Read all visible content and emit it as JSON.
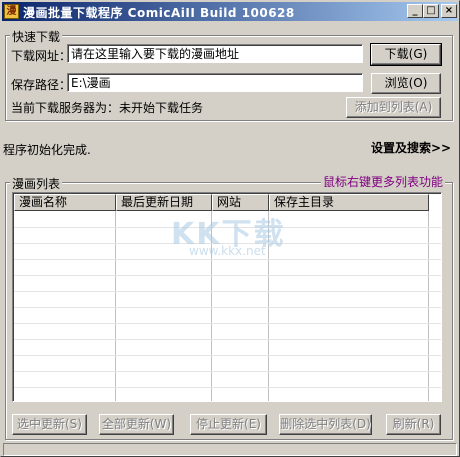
{
  "window": {
    "title": "漫画批量下载程序 ComicAiII Build 100628",
    "controls": {
      "minimize": "_",
      "maximize": "□",
      "close": "×"
    }
  },
  "quick_download": {
    "title": "快速下载",
    "url_label": "下载网址：",
    "url_value": "请在这里输入要下载的漫画地址",
    "download_button": "下载(G)",
    "path_label": "保存路径：",
    "path_value": "E:\\漫画",
    "browse_button": "浏览(O)",
    "server_status": "当前下载服务器为：未开始下载任务",
    "add_list_button": "添加到列表(A)"
  },
  "status_message": "程序初始化完成.",
  "settings_link": "设置及搜索>>",
  "comic_list": {
    "title": "漫画列表",
    "hint": "鼠标右键更多列表功能",
    "columns": [
      "漫画名称",
      "最后更新日期",
      "网站",
      "保存主目录"
    ]
  },
  "bottom_buttons": {
    "update_selected": "选中更新(S)",
    "update_all": "全部更新(W)",
    "stop_update": "停止更新(E)",
    "delete_selected": "删除选中列表(D)",
    "refresh": "刷新(R)"
  },
  "watermark": {
    "logo": "KK下载",
    "url": "www.kkx.net"
  },
  "colors": {
    "hint": "#800080",
    "face": "#d4d0c8",
    "title_start": "#0a246a",
    "title_end": "#a6caf0"
  }
}
